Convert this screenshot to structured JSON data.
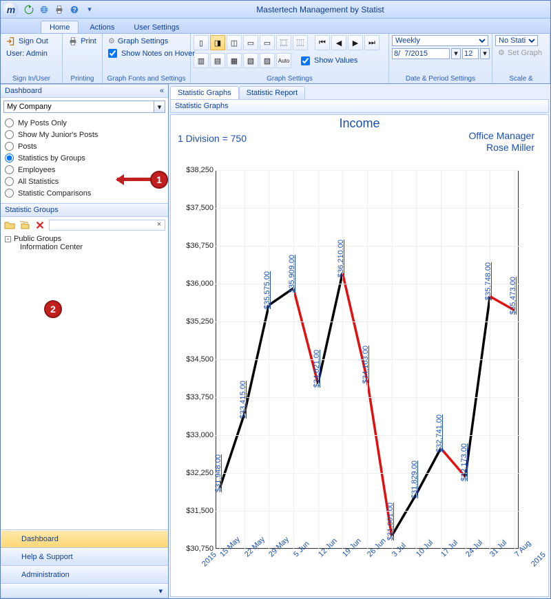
{
  "app": {
    "title": "Mastertech Management by Statist"
  },
  "ribbon": {
    "tabs": [
      "Home",
      "Actions",
      "User Settings"
    ],
    "active_tab": 0,
    "groups": {
      "signin": {
        "sign_out": "Sign Out",
        "user_line": "User: Admin",
        "sign_in": "Sign In/User"
      },
      "printing": {
        "print": "Print",
        "label": "Printing"
      },
      "gfs": {
        "graph_settings": "Graph Settings",
        "show_notes": "Show Notes on Hover",
        "label": "Graph Fonts and Settings"
      },
      "graph_settings": {
        "show_values": "Show Values",
        "label": "Graph Settings"
      },
      "date_period": {
        "period_select": "Weekly",
        "date": "8/  7/2015",
        "num": "12",
        "label": "Date & Period Settings"
      },
      "scale": {
        "no_stat": "No Statistic S",
        "set_graph": "Set Graph",
        "label": "Scale &"
      }
    }
  },
  "sidebar": {
    "header": "Dashboard",
    "company": "My Company",
    "options": [
      "My Posts Only",
      "Show My Junior's Posts",
      "Posts",
      "Statistics by Groups",
      "Employees",
      "All Statistics",
      "Statistic Comparisons"
    ],
    "selected_option": 3,
    "stat_groups_header": "Statistic Groups",
    "tree": {
      "root": "Public Groups",
      "child": "Information Center"
    },
    "nav": {
      "dashboard": "Dashboard",
      "help": "Help & Support",
      "admin": "Administration"
    }
  },
  "main": {
    "tabs": [
      "Statistic Graphs",
      "Statistic Report"
    ],
    "active_tab": 0,
    "breadcrumb": "Statistic Graphs"
  },
  "annotations": {
    "1": "1",
    "2": "2"
  },
  "chart_data": {
    "type": "line",
    "title": "Income",
    "subtitle_left": "1 Division = 750",
    "owner_role": "Office Manager",
    "owner_name": "Rose Miller",
    "ylabel": "",
    "xlabel": "",
    "ylim": [
      30750,
      38250
    ],
    "y_ticks": [
      30750,
      31500,
      32250,
      33000,
      33750,
      34500,
      35250,
      36000,
      36750,
      37500,
      38250
    ],
    "y_tick_labels": [
      "30,750",
      "$31,500",
      "$32,250",
      "$33,000",
      "$33,750",
      "$34,500",
      "$35,250",
      "$36,000",
      "$36,750",
      "$37,500",
      "$38,250"
    ],
    "categories": [
      "15 May",
      "22 May",
      "29 May",
      "5 Jun",
      "12 Jun",
      "19 Jun",
      "26 Jun",
      "3 Jul",
      "10 Jul",
      "17 Jul",
      "24 Jul",
      "31 Jul",
      "7 Aug"
    ],
    "year_start": "2015",
    "year_end": "2015",
    "values": [
      31948.0,
      33415.0,
      35575.0,
      35909.0,
      34021.0,
      36210.0,
      34103.0,
      31001.0,
      31829.0,
      32741.0,
      32173.0,
      35748.0,
      35473.0
    ],
    "value_labels": [
      "$31,948.00",
      "$33,415.00",
      "$35,575.00",
      "$35,909.00",
      "$34,021.00",
      "$36,210.00",
      "$34,103.00",
      "$31,001.00",
      "$31,829.00",
      "$32,741.00",
      "$32,173.00",
      "$35,748.00",
      "$35,473.00"
    ],
    "segment_colors": [
      "black",
      "black",
      "black",
      "red",
      "black",
      "red",
      "red",
      "black",
      "black",
      "red",
      "black",
      "red"
    ]
  }
}
